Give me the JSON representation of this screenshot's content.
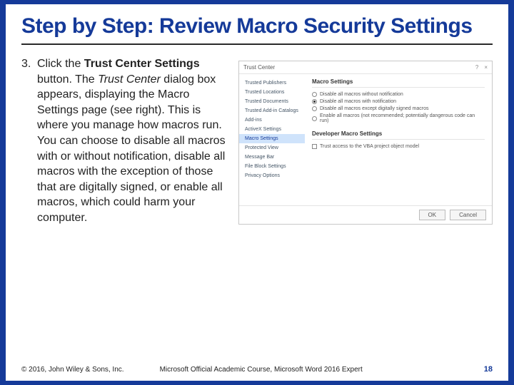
{
  "title": "Step by Step: Review Macro Security Settings",
  "step": {
    "number": "3.",
    "parts": [
      {
        "t": "Click the "
      },
      {
        "t": "Trust Center Settings",
        "b": true
      },
      {
        "t": " button. The "
      },
      {
        "t": "Trust Center",
        "i": true
      },
      {
        "t": " dialog box appears, displaying the Macro Settings page (see right). This is where you manage how macros run. You can choose to disable all macros with or without notification, disable all macros with the exception of those that are digitally signed, or enable all macros, which could harm your computer."
      }
    ]
  },
  "dialog": {
    "title": "Trust Center",
    "help": "?",
    "close": "×",
    "side": [
      "Trusted Publishers",
      "Trusted Locations",
      "Trusted Documents",
      "Trusted Add-in Catalogs",
      "Add-ins",
      "ActiveX Settings",
      "Macro Settings",
      "Protected View",
      "Message Bar",
      "File Block Settings",
      "Privacy Options"
    ],
    "side_selected": 6,
    "main": {
      "heading": "Macro Settings",
      "options": [
        {
          "label": "Disable all macros without notification",
          "checked": false
        },
        {
          "label": "Disable all macros with notification",
          "checked": true
        },
        {
          "label": "Disable all macros except digitally signed macros",
          "checked": false
        },
        {
          "label": "Enable all macros (not recommended; potentially dangerous code can run)",
          "checked": false
        }
      ],
      "dev_heading": "Developer Macro Settings",
      "dev_option": "Trust access to the VBA project object model"
    },
    "ok": "OK",
    "cancel": "Cancel"
  },
  "footer": {
    "copyright": "© 2016, John Wiley & Sons, Inc.",
    "course": "Microsoft Official Academic Course, Microsoft Word 2016 Expert",
    "page": "18"
  }
}
